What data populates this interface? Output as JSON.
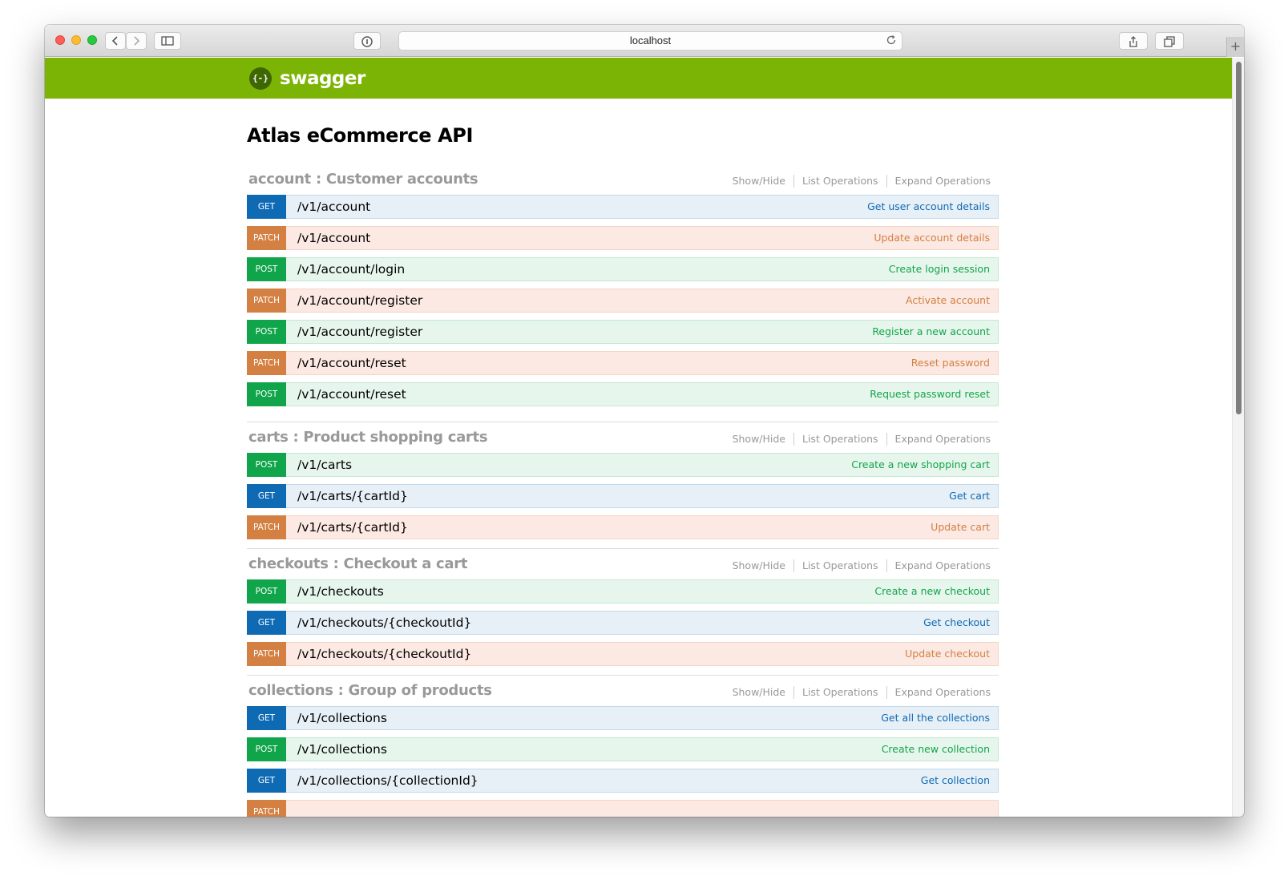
{
  "browser": {
    "url": "localhost",
    "newtab_label": "+"
  },
  "swagger": {
    "logo_glyph": "{-}",
    "brand": "swagger"
  },
  "api_title": "Atlas eCommerce API",
  "resource_links": {
    "show_hide": "Show/Hide",
    "list_operations": "List Operations",
    "expand_operations": "Expand Operations"
  },
  "colors": {
    "header": "#7cb405",
    "get": "#0f6ab4",
    "post": "#10a54a",
    "patch": "#d38042"
  },
  "resources": [
    {
      "title": "account : Customer accounts",
      "operations": [
        {
          "method": "GET",
          "path": "/v1/account",
          "summary": "Get user account details"
        },
        {
          "method": "PATCH",
          "path": "/v1/account",
          "summary": "Update account details"
        },
        {
          "method": "POST",
          "path": "/v1/account/login",
          "summary": "Create login session"
        },
        {
          "method": "PATCH",
          "path": "/v1/account/register",
          "summary": "Activate account"
        },
        {
          "method": "POST",
          "path": "/v1/account/register",
          "summary": "Register a new account"
        },
        {
          "method": "PATCH",
          "path": "/v1/account/reset",
          "summary": "Reset password"
        },
        {
          "method": "POST",
          "path": "/v1/account/reset",
          "summary": "Request password reset"
        }
      ]
    },
    {
      "title": "carts : Product shopping carts",
      "operations": [
        {
          "method": "POST",
          "path": "/v1/carts",
          "summary": "Create a new shopping cart"
        },
        {
          "method": "GET",
          "path": "/v1/carts/{cartId}",
          "summary": "Get cart"
        },
        {
          "method": "PATCH",
          "path": "/v1/carts/{cartId}",
          "summary": "Update cart"
        }
      ]
    },
    {
      "title": "checkouts : Checkout a cart",
      "operations": [
        {
          "method": "POST",
          "path": "/v1/checkouts",
          "summary": "Create a new checkout"
        },
        {
          "method": "GET",
          "path": "/v1/checkouts/{checkoutId}",
          "summary": "Get checkout"
        },
        {
          "method": "PATCH",
          "path": "/v1/checkouts/{checkoutId}",
          "summary": "Update checkout"
        }
      ]
    },
    {
      "title": "collections : Group of products",
      "operations": [
        {
          "method": "GET",
          "path": "/v1/collections",
          "summary": "Get all the collections"
        },
        {
          "method": "POST",
          "path": "/v1/collections",
          "summary": "Create new collection"
        },
        {
          "method": "GET",
          "path": "/v1/collections/{collectionId}",
          "summary": "Get collection"
        },
        {
          "method": "PATCH",
          "path": "",
          "summary": ""
        }
      ]
    }
  ]
}
